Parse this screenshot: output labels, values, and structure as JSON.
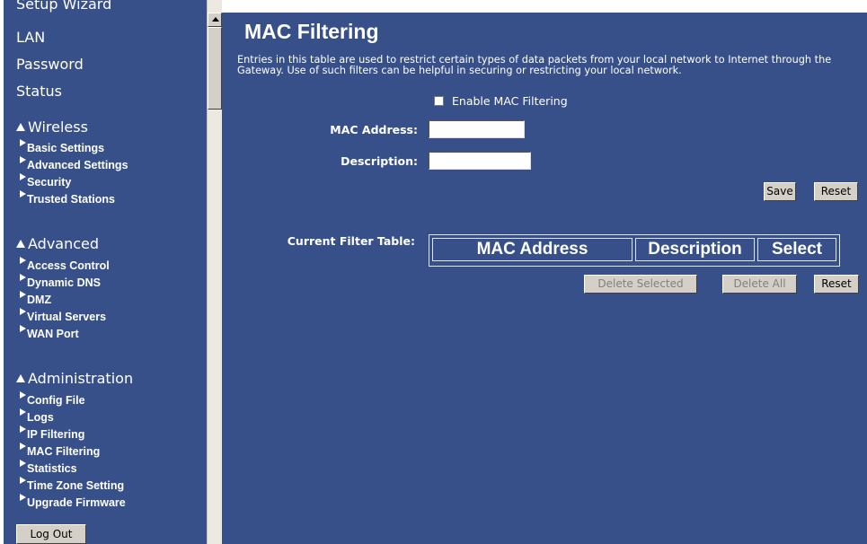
{
  "sidebar": {
    "top_cut_item": "Setup Wizard",
    "links": [
      "LAN",
      "Password",
      "Status"
    ],
    "sections": [
      {
        "title": "Wireless",
        "items": [
          "Basic Settings",
          "Advanced Settings",
          "Security",
          "Trusted Stations"
        ]
      },
      {
        "title": "Advanced",
        "items": [
          "Access Control",
          "Dynamic DNS",
          "DMZ",
          "Virtual Servers",
          "WAN Port"
        ]
      },
      {
        "title": "Administration",
        "items": [
          "Config File",
          "Logs",
          "IP Filtering",
          "MAC Filtering",
          "Statistics",
          "Time Zone Setting",
          "Upgrade Firmware"
        ]
      }
    ],
    "logout": "Log Out"
  },
  "main": {
    "title": "MAC Filtering",
    "description": "Entries in this table are used to restrict certain types of data packets from your local network to Internet through the Gateway. Use of such filters can be helpful in securing or restricting your local network.",
    "enable_label": "Enable MAC Filtering",
    "enable_checked": false,
    "mac_label": "MAC Address:",
    "mac_value": "",
    "desc_label": "Description:",
    "desc_value": "",
    "save": "Save",
    "reset": "Reset",
    "table_label": "Current Filter Table:",
    "columns": [
      "MAC Address",
      "Description",
      "Select"
    ],
    "delete_selected": "Delete Selected",
    "delete_all": "Delete All",
    "reset2": "Reset"
  },
  "colors": {
    "panel": "#38508a",
    "text": "#ffffff",
    "button": "#d4d0c8"
  }
}
